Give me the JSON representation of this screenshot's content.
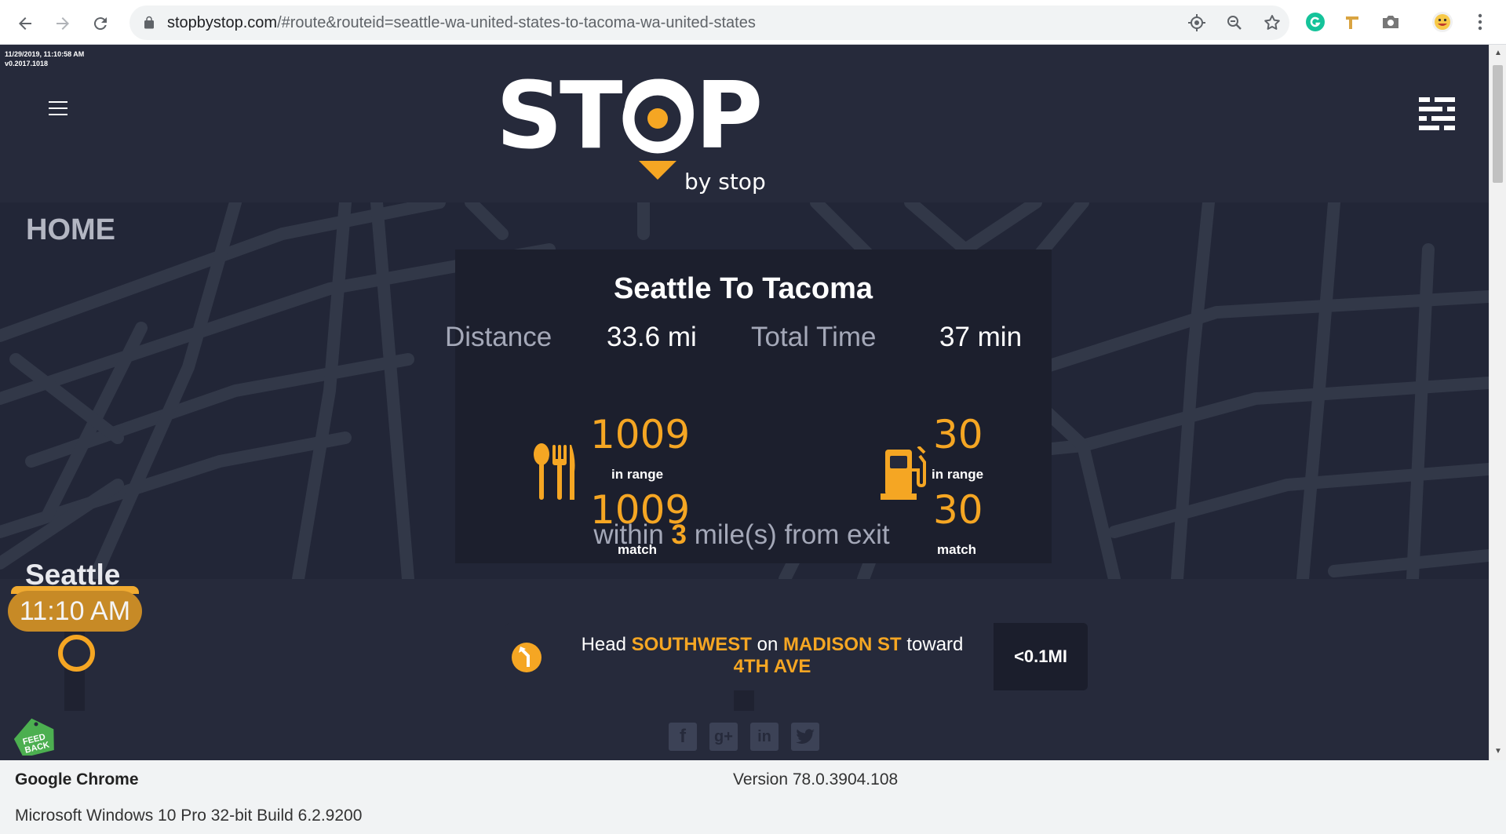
{
  "browser": {
    "url_host": "stopbystop.com",
    "url_path": "/#route&routeid=seattle-wa-united-states-to-tacoma-wa-united-states"
  },
  "page": {
    "stamp_datetime": "11/29/2019, 11:10:58 AM",
    "stamp_version": "v0.2017.1018",
    "logo_text": "STOP",
    "logo_sub": "by stop",
    "home_label": "HOME",
    "route_title": "Seattle To Tacoma",
    "distance_label": "Distance",
    "distance_value": "33.6 mi",
    "time_label": "Total Time",
    "time_value": "37 min",
    "food": {
      "in_range": "1009",
      "in_range_label": "in range",
      "match": "1009",
      "match_label": "match"
    },
    "fuel": {
      "in_range": "30",
      "in_range_label": "in range",
      "match": "30",
      "match_label": "match"
    },
    "within_prefix": "within",
    "within_num": "3",
    "within_suffix": "mile(s) from exit",
    "city": "Seattle",
    "depart_time": "11:10 AM",
    "direction": {
      "head": "Head",
      "dir": "SOUTHWEST",
      "on": "on",
      "street": "MADISON ST",
      "toward": "toward",
      "toward_street": "4TH AVE",
      "distance": "<0.1MI"
    },
    "feedback_label": "FEED BACK"
  },
  "info": {
    "browser_name": "Google Chrome",
    "version": "Version 78.0.3904.108",
    "os": "Microsoft Windows 10 Pro 32-bit Build 6.2.9200"
  },
  "colors": {
    "accent": "#f5a623",
    "background": "#262a3b",
    "map": "#222637"
  }
}
